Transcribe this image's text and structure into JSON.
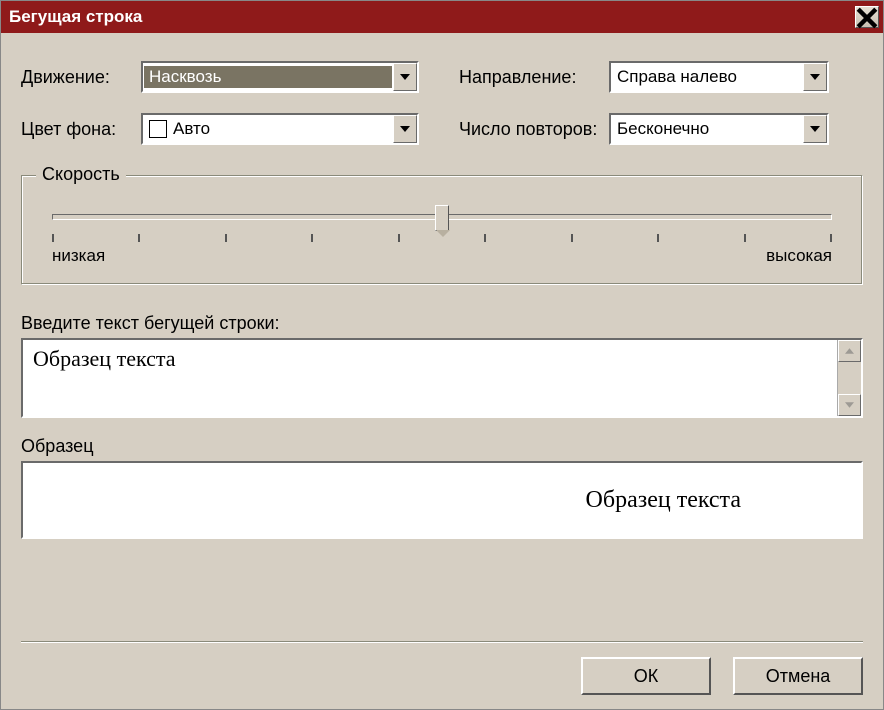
{
  "window": {
    "title": "Бегущая строка"
  },
  "form": {
    "movement": {
      "label": "Движение:",
      "value": "Насквозь"
    },
    "direction": {
      "label": "Направление:",
      "value": "Справа налево"
    },
    "bgcolor": {
      "label": "Цвет фона:",
      "value": "Авто"
    },
    "repeats": {
      "label": "Число повторов:",
      "value": "Бесконечно"
    }
  },
  "speed": {
    "legend": "Скорость",
    "low_label": "низкая",
    "high_label": "высокая",
    "value_percent": 50,
    "ticks": 10
  },
  "textinput": {
    "label": "Введите текст бегущей строки:",
    "value": "Образец текста"
  },
  "preview": {
    "label": "Образец",
    "text": "Образец текста"
  },
  "buttons": {
    "ok": "ОК",
    "cancel": "Отмена"
  }
}
